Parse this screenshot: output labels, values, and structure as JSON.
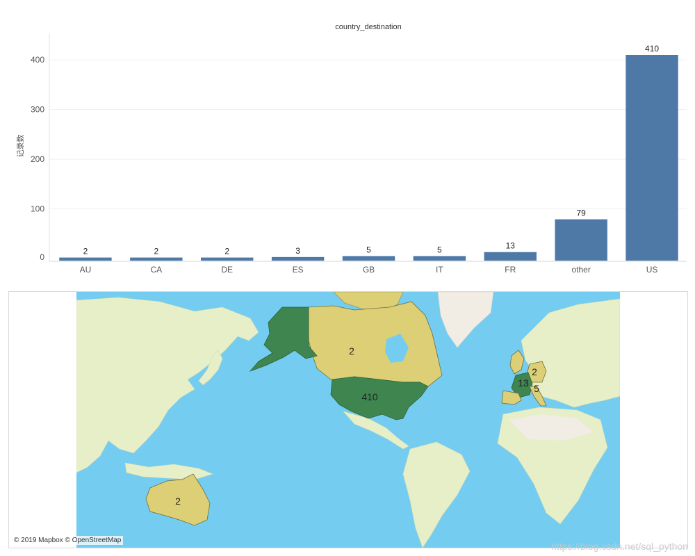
{
  "chart_data": {
    "type": "bar",
    "title": "country_destination",
    "ylabel": "记录数",
    "xlabel": "",
    "categories": [
      "AU",
      "CA",
      "DE",
      "ES",
      "GB",
      "IT",
      "FR",
      "other",
      "US"
    ],
    "values": [
      2,
      2,
      2,
      3,
      5,
      5,
      13,
      79,
      410
    ],
    "ylim": [
      0,
      410
    ],
    "yticks": [
      0,
      100,
      200,
      300,
      400
    ],
    "grid": true,
    "bar_color": "#4e79a7"
  },
  "map": {
    "type": "choropleth",
    "labels": [
      {
        "country": "Canada",
        "value": "2"
      },
      {
        "country": "US",
        "value": "410"
      },
      {
        "country": "Australia",
        "value": "2"
      },
      {
        "country": "France",
        "value": "13"
      },
      {
        "country": "Germany",
        "value": "2"
      },
      {
        "country": "Italy",
        "value": "5"
      }
    ],
    "colors": {
      "ocean": "#74cdf0",
      "land": "#e7efc9",
      "ice": "#f1ece4",
      "low_value": "#dccf76",
      "high_value": "#3f8550"
    },
    "attribution": "© 2019 Mapbox © OpenStreetMap"
  },
  "watermark": "https://blog.csdn.net/sql_python"
}
